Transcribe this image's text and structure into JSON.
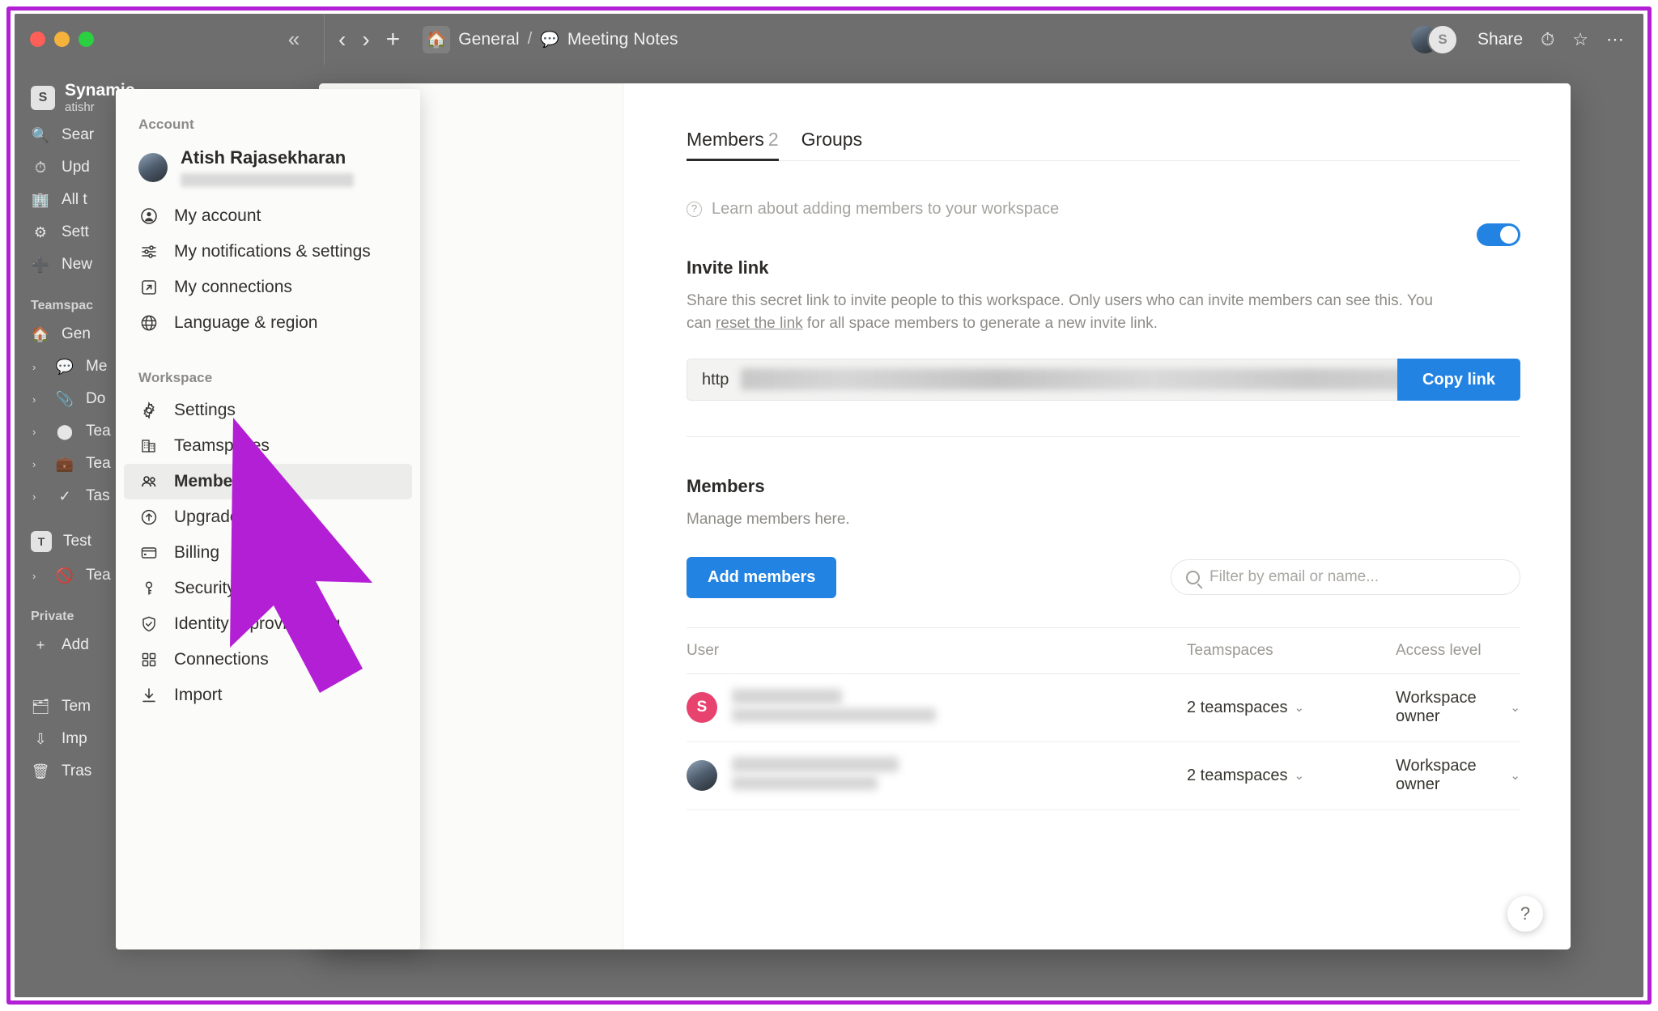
{
  "titlebar": {
    "collapse_icon": "chevrons-left-icon",
    "back_icon": "chevron-left-icon",
    "forward_icon": "chevron-right-icon",
    "new_icon": "plus-icon",
    "breadcrumb_home_icon": "house-icon",
    "breadcrumb_workspace": "General",
    "breadcrumb_separator": "/",
    "breadcrumb_page_icon": "speech-bubble-icon",
    "breadcrumb_page": "Meeting Notes",
    "avatar_initial": "S",
    "share_label": "Share",
    "history_icon": "clock-icon",
    "favorite_icon": "star-icon",
    "more_icon": "ellipsis-icon"
  },
  "sidebar": {
    "workspace_badge": "S",
    "workspace_name": "Synamic",
    "workspace_user": "atishr",
    "items": [
      {
        "label": "Sear",
        "icon": "search-icon"
      },
      {
        "label": "Upd",
        "icon": "clock-icon"
      },
      {
        "label": "All t",
        "icon": "building-icon"
      },
      {
        "label": "Sett",
        "icon": "gear-icon"
      },
      {
        "label": "New",
        "icon": "plus-circle-icon"
      }
    ],
    "teamspaces_label": "Teamspac",
    "teamspace_items": [
      {
        "label": "Gen",
        "icon": "house-icon"
      },
      {
        "label": "Me",
        "icon": "speech-bubble-icon"
      },
      {
        "label": "Do",
        "icon": "paperclip-icon"
      },
      {
        "label": "Tea",
        "icon": "circle-icon"
      },
      {
        "label": "Tea",
        "icon": "bag-icon"
      },
      {
        "label": "Tas",
        "icon": "check-icon"
      }
    ],
    "test_label": "Test",
    "test_badge": "T",
    "test_child": "Tea",
    "private_label": "Private",
    "private_add": "Add",
    "bottom_items": [
      {
        "label": "Tem",
        "icon": "template-icon"
      },
      {
        "label": "Imp",
        "icon": "download-icon"
      },
      {
        "label": "Tras",
        "icon": "trash-icon"
      }
    ]
  },
  "account_menu": {
    "account_section_label": "Account",
    "user_name": "Atish Rajasekharan",
    "account_items": [
      {
        "label": "My account",
        "icon": "user-circle-icon"
      },
      {
        "label": "My notifications & settings",
        "icon": "sliders-icon"
      },
      {
        "label": "My connections",
        "icon": "external-link-icon"
      },
      {
        "label": "Language & region",
        "icon": "globe-icon"
      }
    ],
    "workspace_section_label": "Workspace",
    "workspace_items": [
      {
        "label": "Settings",
        "icon": "gear-icon",
        "highlight": false
      },
      {
        "label": "Teamspaces",
        "icon": "building-icon",
        "highlight": false
      },
      {
        "label": "Members",
        "icon": "people-icon",
        "highlight": true
      },
      {
        "label": "Upgrade",
        "icon": "arrow-up-circle-icon",
        "highlight": false
      },
      {
        "label": "Billing",
        "icon": "credit-card-icon",
        "highlight": false
      },
      {
        "label": "Security",
        "icon": "key-icon",
        "highlight": false
      },
      {
        "label": "Identity & provisioning",
        "icon": "shield-check-icon",
        "highlight": false
      },
      {
        "label": "Connections",
        "icon": "grid-icon",
        "highlight": false
      },
      {
        "label": "Import",
        "icon": "download-icon",
        "highlight": false
      }
    ]
  },
  "main": {
    "tabs": [
      {
        "label": "Members",
        "count": "2",
        "active": true
      },
      {
        "label": "Groups",
        "count": "",
        "active": false
      }
    ],
    "learn_link": "Learn about adding members to your workspace",
    "learn_icon": "question-circle-icon",
    "invite": {
      "title": "Invite link",
      "description_line1": "Share this secret link to invite people to this workspace. Only users who can invite members can see this. You",
      "description_pre": "can ",
      "description_link": "reset the link",
      "description_post": " for all space members to generate a new invite link.",
      "toggle_on": true,
      "toggle_color": "#2383e2",
      "link_value": "http",
      "copy_label": "Copy link"
    },
    "members": {
      "title": "Members",
      "description": "Manage members here.",
      "add_button": "Add members",
      "filter_placeholder": "Filter by email or name...",
      "filter_value": "",
      "columns": [
        "User",
        "Teamspaces",
        "Access level"
      ],
      "rows": [
        {
          "avatar_initial": "S",
          "avatar_color": "#e8436f",
          "avatar_type": "initial",
          "teamspaces": "2 teamspaces",
          "access_level": "Workspace owner"
        },
        {
          "avatar_initial": "",
          "avatar_color": "",
          "avatar_type": "photo",
          "teamspaces": "2 teamspaces",
          "access_level": "Workspace owner"
        }
      ]
    },
    "help_icon": "question-mark-icon"
  },
  "annotation": {
    "arrow_color": "#b31fd4",
    "border_color": "#b31fd4"
  }
}
